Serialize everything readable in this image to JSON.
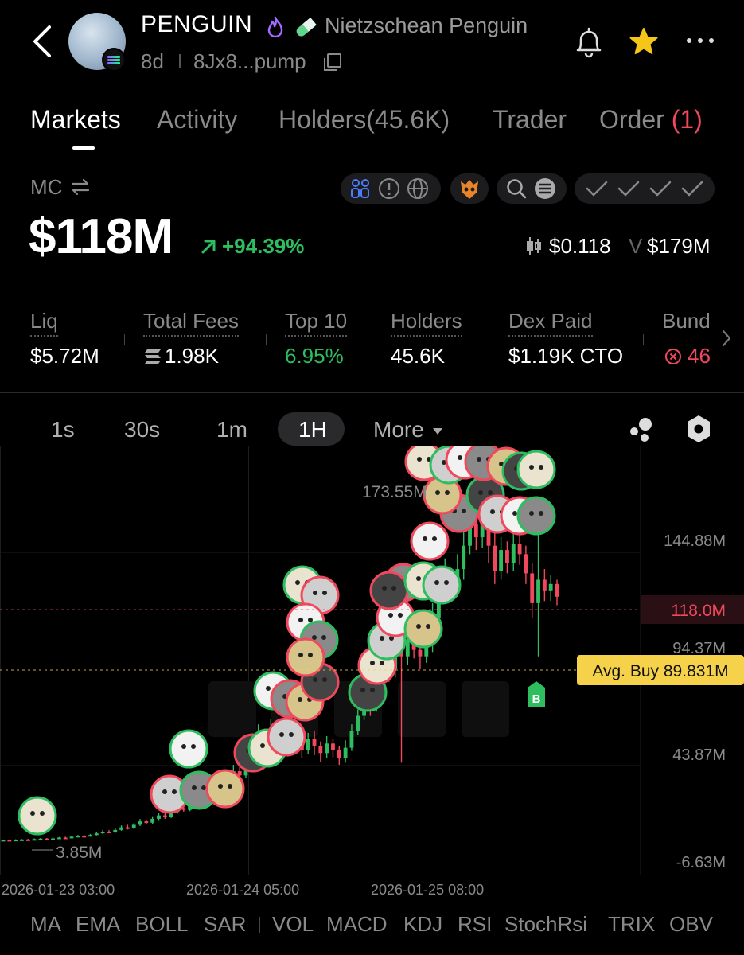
{
  "header": {
    "symbol": "PENGUIN",
    "name": "Nietzschean Penguin",
    "age": "8d",
    "address": "8Jx8...pump",
    "icons": [
      "back-icon",
      "fire-icon",
      "pill-icon",
      "copy-icon",
      "bell-icon",
      "star-icon",
      "more-icon"
    ]
  },
  "tabs": [
    {
      "label": "Markets",
      "active": true
    },
    {
      "label": "Activity"
    },
    {
      "label": "Holders(45.6K)"
    },
    {
      "label": "Trader"
    },
    {
      "label": "Order",
      "count": "(1)"
    }
  ],
  "market": {
    "mc_label": "MC",
    "mc_value": "$118M",
    "change": "+94.39%",
    "price": "$0.118",
    "volume_prefix": "V",
    "volume": "$179M"
  },
  "stats": [
    {
      "label": "Liq",
      "value": "$5.72M"
    },
    {
      "label": "Total Fees",
      "value": "1.98K"
    },
    {
      "label": "Top 10",
      "value": "6.95%"
    },
    {
      "label": "Holders",
      "value": "45.6K"
    },
    {
      "label": "Dex Paid",
      "value": "$1.19K CTO"
    },
    {
      "label": "Bund",
      "value": "46"
    }
  ],
  "intervals": {
    "items": [
      "1s",
      "30s",
      "1m",
      "1H"
    ],
    "active": "1H",
    "more_label": "More"
  },
  "chart_data": {
    "type": "candlestick",
    "y_axis_labels": [
      "144.88M",
      "94.37M",
      "43.87M",
      "-6.63M"
    ],
    "x_axis_labels": [
      "2026-01-23 03:00",
      "2026-01-24 05:00",
      "2026-01-25 08:00"
    ],
    "high_marker": "173.55M",
    "low_marker": "3.85M",
    "current_marker": "118.0M",
    "avg_buy_label": "Avg. Buy 89.831M",
    "buy_marker": "B",
    "ylim": [
      -6.63,
      180
    ],
    "candles": [
      [
        3.6,
        3.7,
        3.5,
        3.8
      ],
      [
        3.7,
        3.6,
        3.5,
        3.9
      ],
      [
        3.6,
        3.8,
        3.5,
        4.0
      ],
      [
        3.8,
        3.9,
        3.6,
        4.1
      ],
      [
        3.9,
        3.8,
        3.7,
        4.2
      ],
      [
        3.8,
        4.1,
        3.7,
        4.4
      ],
      [
        4.1,
        4.3,
        3.9,
        4.6
      ],
      [
        4.3,
        4.0,
        3.8,
        4.6
      ],
      [
        4.0,
        4.4,
        3.9,
        4.8
      ],
      [
        4.4,
        4.8,
        4.2,
        5.1
      ],
      [
        4.8,
        4.6,
        4.3,
        5.2
      ],
      [
        4.6,
        5.2,
        4.4,
        5.6
      ],
      [
        5.2,
        5.6,
        5.0,
        6.0
      ],
      [
        5.6,
        5.4,
        5.1,
        6.1
      ],
      [
        5.4,
        6.0,
        5.2,
        6.5
      ],
      [
        6.0,
        6.8,
        5.8,
        7.4
      ],
      [
        6.8,
        7.6,
        6.5,
        8.4
      ],
      [
        7.6,
        7.2,
        6.8,
        8.3
      ],
      [
        7.2,
        8.4,
        7.0,
        9.2
      ],
      [
        8.4,
        9.6,
        8.0,
        10.5
      ],
      [
        9.6,
        9.2,
        8.6,
        10.8
      ],
      [
        9.2,
        10.8,
        8.8,
        11.6
      ],
      [
        10.8,
        12.4,
        10.2,
        13.5
      ],
      [
        12.4,
        11.8,
        11.0,
        13.2
      ],
      [
        11.8,
        13.6,
        11.2,
        14.8
      ],
      [
        13.6,
        15.2,
        13.0,
        16.2
      ],
      [
        15.2,
        14.4,
        13.6,
        16.4
      ],
      [
        14.4,
        16.8,
        14.0,
        18.0
      ],
      [
        16.8,
        18.6,
        16.0,
        20.0
      ],
      [
        18.6,
        17.8,
        17.0,
        20.2
      ],
      [
        17.8,
        20.4,
        17.2,
        22.0
      ],
      [
        20.4,
        22.8,
        19.8,
        24.6
      ],
      [
        22.8,
        21.6,
        20.6,
        24.2
      ],
      [
        21.6,
        25.2,
        21.0,
        27.0
      ],
      [
        25.2,
        28.6,
        24.4,
        30.5
      ],
      [
        28.6,
        27.0,
        25.8,
        30.2
      ],
      [
        27.0,
        31.5,
        26.4,
        33.5
      ],
      [
        31.5,
        36.0,
        30.6,
        39.0
      ],
      [
        36.0,
        34.0,
        32.0,
        38.5
      ],
      [
        34.0,
        39.5,
        33.0,
        42.0
      ],
      [
        39.5,
        46.0,
        38.5,
        52.0
      ],
      [
        46.0,
        52.0,
        44.0,
        58.0
      ],
      [
        52.0,
        48.0,
        44.5,
        56.0
      ],
      [
        48.0,
        55.0,
        46.5,
        60.5
      ],
      [
        55.0,
        50.0,
        46.0,
        58.0
      ],
      [
        50.0,
        47.0,
        43.0,
        53.0
      ],
      [
        47.0,
        52.5,
        45.0,
        56.0
      ],
      [
        52.5,
        49.0,
        45.5,
        55.0
      ],
      [
        49.0,
        46.0,
        42.0,
        52.0
      ],
      [
        46.0,
        51.0,
        44.0,
        54.0
      ],
      [
        51.0,
        48.0,
        43.5,
        55.0
      ],
      [
        48.0,
        44.5,
        40.5,
        50.0
      ],
      [
        44.5,
        49.0,
        42.0,
        52.5
      ],
      [
        49.0,
        46.0,
        42.5,
        51.0
      ],
      [
        46.0,
        42.0,
        39.0,
        48.0
      ],
      [
        42.0,
        47.0,
        40.0,
        50.5
      ],
      [
        47.0,
        55.0,
        45.5,
        58.0
      ],
      [
        55.0,
        62.0,
        53.0,
        65.0
      ],
      [
        62.0,
        70.0,
        60.0,
        74.0
      ],
      [
        70.0,
        66.0,
        62.0,
        73.0
      ],
      [
        66.0,
        78.0,
        64.0,
        82.0
      ],
      [
        78.0,
        88.0,
        75.0,
        96.0
      ],
      [
        88.0,
        84.0,
        78.0,
        92.0
      ],
      [
        84.0,
        94.0,
        80.0,
        100.0
      ],
      [
        94.0,
        90.0,
        40.0,
        104.0
      ],
      [
        90.0,
        98.0,
        86.0,
        104.0
      ],
      [
        98.0,
        93.0,
        89.0,
        102.0
      ],
      [
        93.0,
        90.0,
        84.0,
        98.0
      ],
      [
        90.0,
        96.0,
        87.0,
        101.0
      ],
      [
        96.0,
        108.0,
        92.0,
        115.0
      ],
      [
        108.0,
        119.0,
        104.0,
        127.0
      ],
      [
        119.0,
        127.0,
        115.0,
        136.0
      ],
      [
        127.0,
        122.0,
        117.0,
        131.0
      ],
      [
        122.0,
        131.0,
        118.0,
        138.0
      ],
      [
        131.0,
        142.0,
        126.0,
        153.0
      ],
      [
        142.0,
        152.0,
        138.0,
        162.0
      ],
      [
        152.0,
        146.0,
        140.0,
        168.0
      ],
      [
        146.0,
        156.0,
        141.0,
        173.55
      ],
      [
        156.0,
        142.0,
        134.0,
        161.0
      ],
      [
        142.0,
        130.0,
        124.0,
        149.0
      ],
      [
        130.0,
        140.0,
        126.0,
        146.0
      ],
      [
        140.0,
        134.0,
        129.0,
        144.0
      ],
      [
        134.0,
        143.0,
        130.0,
        151.0
      ],
      [
        143.0,
        138.0,
        133.0,
        147.0
      ],
      [
        138.0,
        129.0,
        124.0,
        142.0
      ],
      [
        129.0,
        115.0,
        108.0,
        134.0
      ],
      [
        115.0,
        126.0,
        90.0,
        147.0
      ],
      [
        126.0,
        121.0,
        116.0,
        131.0
      ],
      [
        121.0,
        124.0,
        116.0,
        128.0
      ],
      [
        124.0,
        118.0,
        114.0,
        126.0
      ]
    ]
  },
  "indicators": [
    "MA",
    "EMA",
    "BOLL",
    "SAR",
    "VOL",
    "MACD",
    "KDJ",
    "RSI",
    "StochRsi",
    "TRIX",
    "OBV"
  ],
  "colors": {
    "up": "#2ebd5f",
    "down": "#f0485c",
    "accent_yellow": "#f5d24a",
    "muted": "#8a8a8a"
  }
}
